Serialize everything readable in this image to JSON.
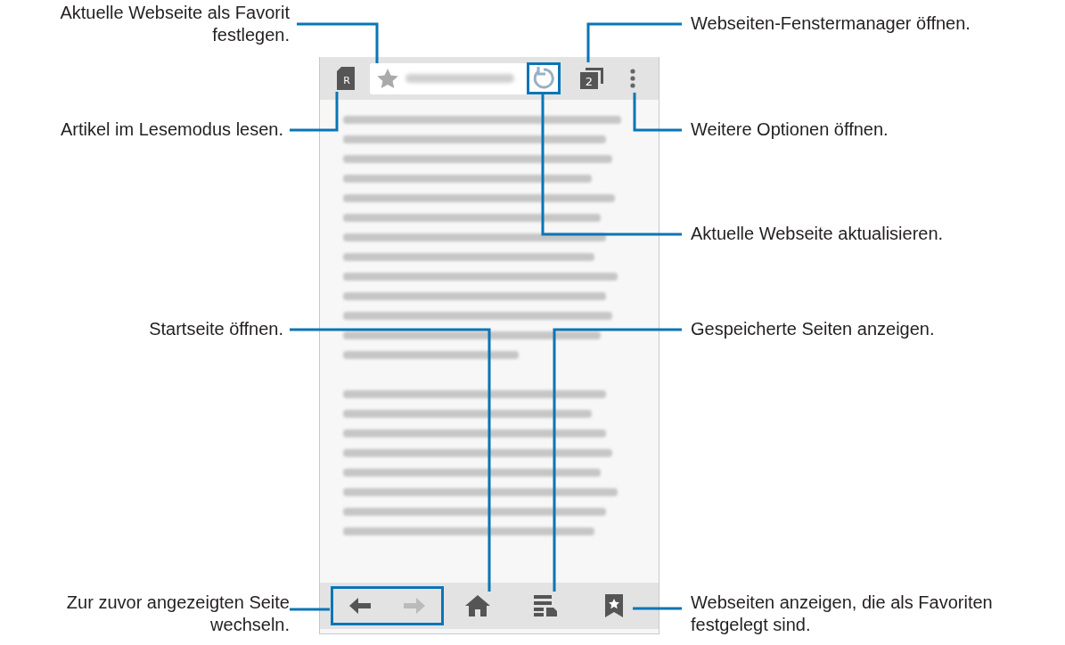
{
  "browser": {
    "top_bar": {
      "reader_icon_letter": "R",
      "refresh_highlighted": true,
      "tab_count": "2"
    },
    "bottom_bar": {
      "nav_highlighted": true,
      "back_disabled": false,
      "forward_disabled": true
    }
  },
  "callouts_left": [
    "Aktuelle Webseite als Favorit\nfestlegen.",
    "Artikel im Lesemodus lesen.",
    "Startseite öffnen.",
    "Zur zuvor angezeigten Seite\nwechseln."
  ],
  "callouts_right": [
    "Webseiten-Fenstermanager öffnen.",
    "Weitere Optionen öffnen.",
    "Aktuelle Webseite aktualisieren.",
    "Gespeicherte Seiten anzeigen.",
    "Webseiten anzeigen, die als Favoriten\nfestgelegt sind."
  ]
}
